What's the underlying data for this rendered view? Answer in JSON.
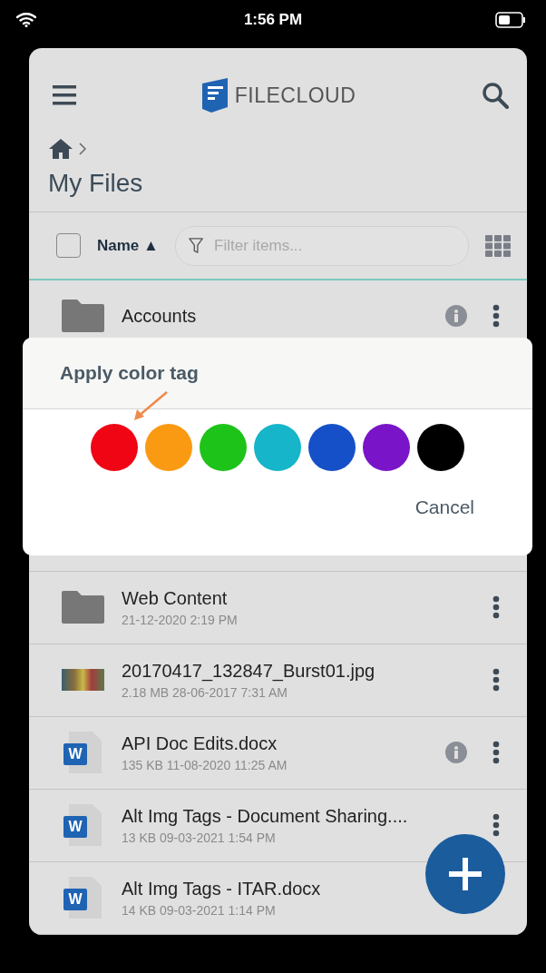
{
  "status_bar": {
    "time": "1:56 PM"
  },
  "header": {
    "logo_text": "FILECLOUD"
  },
  "page_title": "My Files",
  "toolbar": {
    "select_all_checked": false,
    "sort_label": "Name",
    "sort_indicator": "▲",
    "filter_placeholder": "Filter items..."
  },
  "files": [
    {
      "kind": "folder",
      "name": "Accounts",
      "info": true
    },
    {
      "kind": "folder",
      "name": "Web Content",
      "meta": "21-12-2020 2:19 PM",
      "info": false
    },
    {
      "kind": "image",
      "name": "20170417_132847_Burst01.jpg",
      "meta": "2.18 MB 28-06-2017 7:31 AM",
      "info": false
    },
    {
      "kind": "word",
      "badge": "W",
      "name": "API Doc Edits.docx",
      "meta": "135 KB 11-08-2020 11:25 AM",
      "info": true
    },
    {
      "kind": "word",
      "badge": "W",
      "name": "Alt Img Tags - Document Sharing....",
      "meta": "13 KB 09-03-2021 1:54 PM",
      "info": false
    },
    {
      "kind": "word",
      "badge": "W",
      "name": "Alt Img Tags - ITAR.docx",
      "meta": "14 KB 09-03-2021 1:14 PM",
      "info": false
    }
  ],
  "color_dialog": {
    "title": "Apply color tag",
    "colors": [
      {
        "color": "#f00515"
      },
      {
        "color": "#fa9a12"
      },
      {
        "color": "#1ec31a"
      },
      {
        "color": "#16b5c9"
      },
      {
        "color": "#1550c9"
      },
      {
        "color": "#7a14c8"
      },
      {
        "color": "#000000"
      }
    ],
    "cancel_label": "Cancel"
  }
}
